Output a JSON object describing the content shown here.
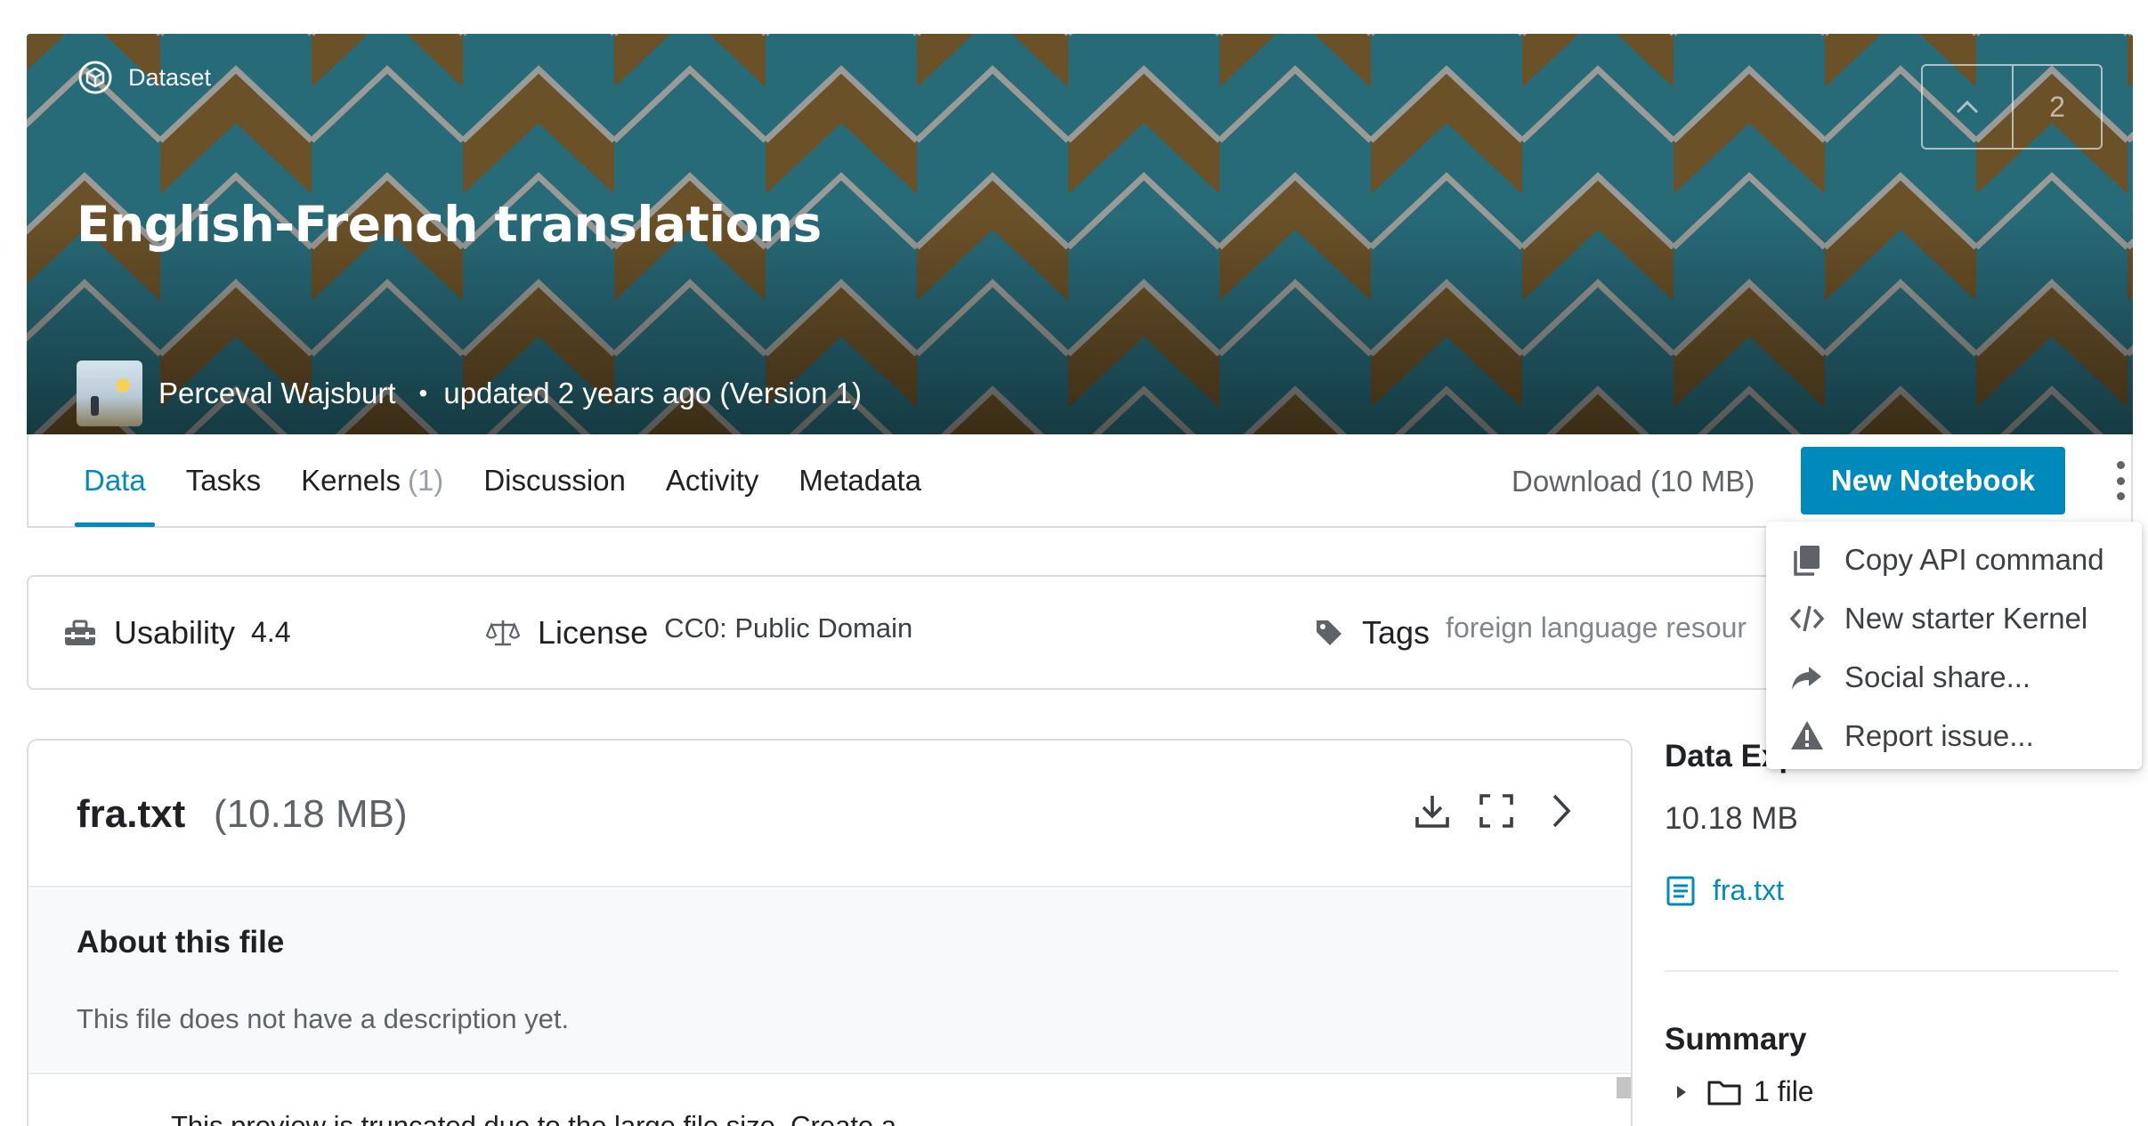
{
  "hero": {
    "type_label": "Dataset",
    "title": "English-French translations",
    "author": "Perceval Wajsburt",
    "separator": "•",
    "updated": "updated 2 years ago (Version 1)",
    "vote_count": "2",
    "colors": {
      "brown": "#6a5128",
      "teal": "#276a78",
      "stripe": "#9a9a96"
    }
  },
  "tabs": [
    {
      "label": "Data",
      "count": ""
    },
    {
      "label": "Tasks",
      "count": ""
    },
    {
      "label": "Kernels",
      "count": "(1)"
    },
    {
      "label": "Discussion",
      "count": ""
    },
    {
      "label": "Activity",
      "count": ""
    },
    {
      "label": "Metadata",
      "count": ""
    }
  ],
  "toolbar": {
    "download_label": "Download (10 MB)",
    "new_notebook_label": "New Notebook",
    "accent_color": "#008abc"
  },
  "info": {
    "usability_label": "Usability",
    "usability_value": "4.4",
    "license_label": "License",
    "license_value": "CC0: Public Domain",
    "tags_label": "Tags",
    "tags_value": "foreign language resour"
  },
  "file": {
    "name": "fra.txt",
    "size": "(10.18 MB)",
    "about_title": "About this file",
    "about_desc": "This file does not have a description yet.",
    "truncate_note": "This preview is truncated due to the large file size. Create a"
  },
  "sidebar": {
    "title": "Data Explorer",
    "size": "10.18 MB",
    "file_link": "fra.txt",
    "summary_title": "Summary",
    "summary_files": "1 file"
  },
  "menu": {
    "items": [
      {
        "label": "Copy API command",
        "icon": "copy-icon"
      },
      {
        "label": "New starter Kernel",
        "icon": "code-icon"
      },
      {
        "label": "Social share...",
        "icon": "share-icon"
      },
      {
        "label": "Report issue...",
        "icon": "warning-icon"
      }
    ]
  }
}
